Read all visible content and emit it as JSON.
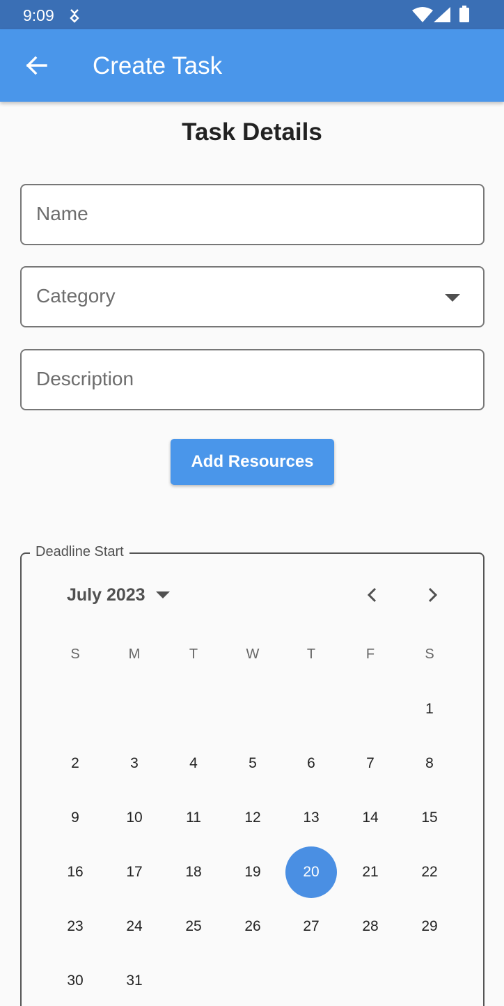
{
  "status_bar": {
    "time": "9:09"
  },
  "app_bar": {
    "title": "Create Task"
  },
  "page": {
    "section_title": "Task Details"
  },
  "form": {
    "name_placeholder": "Name",
    "category_placeholder": "Category",
    "description_placeholder": "Description",
    "add_resources_label": "Add Resources"
  },
  "calendar": {
    "legend": "Deadline Start",
    "month_label": "July 2023",
    "weekdays": [
      "S",
      "M",
      "T",
      "W",
      "T",
      "F",
      "S"
    ],
    "days": [
      [
        "",
        "",
        "",
        "",
        "",
        "",
        "1"
      ],
      [
        "2",
        "3",
        "4",
        "5",
        "6",
        "7",
        "8"
      ],
      [
        "9",
        "10",
        "11",
        "12",
        "13",
        "14",
        "15"
      ],
      [
        "16",
        "17",
        "18",
        "19",
        "20",
        "21",
        "22"
      ],
      [
        "23",
        "24",
        "25",
        "26",
        "27",
        "28",
        "29"
      ],
      [
        "30",
        "31",
        "",
        "",
        "",
        "",
        ""
      ]
    ],
    "selected_day": "20"
  },
  "colors": {
    "status_bar": "#3a6fb5",
    "app_bar": "#4a96ea",
    "accent": "#4a8fe3"
  }
}
